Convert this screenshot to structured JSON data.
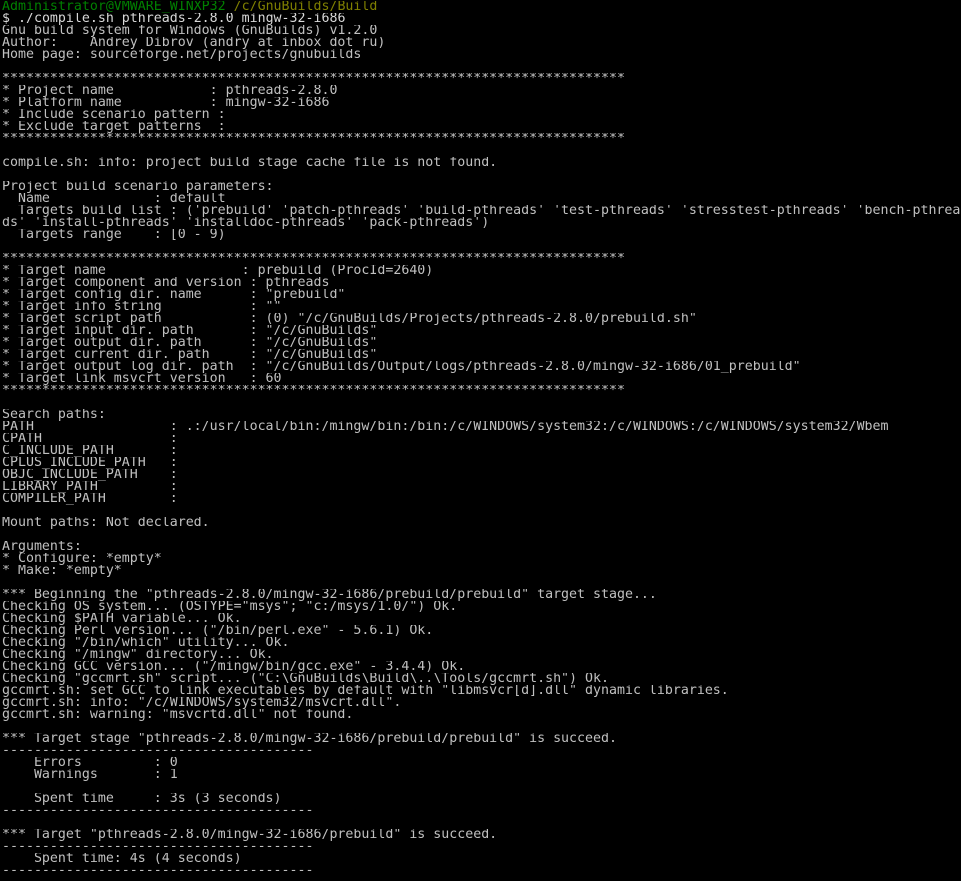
{
  "window": {
    "type": "terminal",
    "title": "MSYS bash shell",
    "columns": 119,
    "rows": 73,
    "background_color": "#000000",
    "foreground_color": "#c0c0c0",
    "prompt_user_color": "#008000",
    "prompt_path_color": "#808000"
  },
  "prompt": {
    "user_host": "Administrator@VMWARE_WINXP32",
    "separator": " ",
    "path": "/c/GnuBuilds/Build",
    "dollar": "$",
    "command": " ./compile.sh pthreads-2.8.0 mingw-32-i686"
  },
  "lines": [
    {
      "id": "prompt-line",
      "type": "prompt"
    },
    {
      "id": "command-line",
      "type": "command"
    },
    {
      "id": "banner-title",
      "text": "Gnu build system for Windows (GnuBuilds) v1.2.0"
    },
    {
      "id": "author",
      "text": "Author:    Andrey Dibrov (andry at inbox dot ru)"
    },
    {
      "id": "homepage",
      "text": "Home page: sourceforge.net/projects/gnubuilds"
    },
    {
      "id": "blank-1",
      "text": ""
    },
    {
      "id": "stars-1",
      "text": "******************************************************************************"
    },
    {
      "id": "project-name",
      "text": "* Project name            : pthreads-2.8.0"
    },
    {
      "id": "platform-name",
      "text": "* Platform name           : mingw-32-i686"
    },
    {
      "id": "include-scenario",
      "text": "* Include scenario pattern :"
    },
    {
      "id": "exclude-target",
      "text": "* Exclude target patterns  :"
    },
    {
      "id": "stars-2",
      "text": "******************************************************************************"
    },
    {
      "id": "blank-2",
      "text": ""
    },
    {
      "id": "cache-info",
      "text": "compile.sh: info: project build stage cache file is not found."
    },
    {
      "id": "blank-3",
      "text": ""
    },
    {
      "id": "scenario-header",
      "text": "Project build scenario parameters:"
    },
    {
      "id": "scenario-name",
      "text": "  Name             : default"
    },
    {
      "id": "targets-build-list-1",
      "text": "  Targets build list : ('prebuild' 'patch-pthreads' 'build-pthreads' 'test-pthreads' 'stresstest-pthreads' 'bench-pthrea"
    },
    {
      "id": "targets-build-list-2",
      "text": "ds' 'install-pthreads' 'installdoc-pthreads' 'pack-pthreads')"
    },
    {
      "id": "targets-range",
      "text": "  Targets range    : [0 - 9)"
    },
    {
      "id": "blank-4",
      "text": ""
    },
    {
      "id": "stars-3",
      "text": "******************************************************************************"
    },
    {
      "id": "target-name",
      "text": "* Target name                 : prebuild (ProcId=2640)"
    },
    {
      "id": "target-component",
      "text": "* Target component and version : pthreads"
    },
    {
      "id": "target-config-dir",
      "text": "* Target config dir. name      : \"prebuild\""
    },
    {
      "id": "target-info-string",
      "text": "* Target info string           : \"\""
    },
    {
      "id": "target-script-path",
      "text": "* Target script path           : (0) \"/c/GnuBuilds/Projects/pthreads-2.8.0/prebuild.sh\""
    },
    {
      "id": "target-input-dir",
      "text": "* Target input dir. path       : \"/c/GnuBuilds\""
    },
    {
      "id": "target-output-dir",
      "text": "* Target output dir. path      : \"/c/GnuBuilds\""
    },
    {
      "id": "target-current-dir",
      "text": "* Target current dir. path     : \"/c/GnuBuilds\""
    },
    {
      "id": "target-output-log-dir",
      "text": "* Target output log dir. path  : \"/c/GnuBuilds/Output/logs/pthreads-2.8.0/mingw-32-i686/01_prebuild\""
    },
    {
      "id": "target-link-msvcrt",
      "text": "* Target link msvcrt version   : 60"
    },
    {
      "id": "stars-4",
      "text": "******************************************************************************"
    },
    {
      "id": "blank-5",
      "text": ""
    },
    {
      "id": "search-paths-header",
      "text": "Search paths:"
    },
    {
      "id": "env-path",
      "text": "PATH                 : .:/usr/local/bin:/mingw/bin:/bin:/c/WINDOWS/system32:/c/WINDOWS:/c/WINDOWS/system32/Wbem"
    },
    {
      "id": "env-cpath",
      "text": "CPATH                :"
    },
    {
      "id": "env-c-include-path",
      "text": "C_INCLUDE_PATH       :"
    },
    {
      "id": "env-cplus-include-path",
      "text": "CPLUS_INCLUDE_PATH   :"
    },
    {
      "id": "env-objc-include-path",
      "text": "OBJC_INCLUDE_PATH    :"
    },
    {
      "id": "env-library-path",
      "text": "LIBRARY_PATH         :"
    },
    {
      "id": "env-compiler-path",
      "text": "COMPILER_PATH        :"
    },
    {
      "id": "blank-6",
      "text": ""
    },
    {
      "id": "mount-paths",
      "text": "Mount paths: Not declared."
    },
    {
      "id": "blank-7",
      "text": ""
    },
    {
      "id": "arguments-header",
      "text": "Arguments:"
    },
    {
      "id": "arg-configure",
      "text": "* Configure: *empty*"
    },
    {
      "id": "arg-make",
      "text": "* Make: *empty*"
    },
    {
      "id": "blank-8",
      "text": ""
    },
    {
      "id": "beginning-stage",
      "text": "*** Beginning the \"pthreads-2.8.0/mingw-32-i686/prebuild/prebuild\" target stage..."
    },
    {
      "id": "check-os",
      "text": "Checking OS system... (OSTYPE=\"msys\"; \"c:/msys/1.0/\") Ok."
    },
    {
      "id": "check-path-var",
      "text": "Checking $PATH variable... Ok."
    },
    {
      "id": "check-perl",
      "text": "Checking Perl version... (\"/bin/perl.exe\" - 5.6.1) Ok."
    },
    {
      "id": "check-which",
      "text": "Checking \"/bin/which\" utility... Ok."
    },
    {
      "id": "check-mingw-dir",
      "text": "Checking \"/mingw\" directory... Ok."
    },
    {
      "id": "check-gcc",
      "text": "Checking GCC version... (\"/mingw/bin/gcc.exe\" - 3.4.4) Ok."
    },
    {
      "id": "check-gccmrt",
      "text": "Checking \"gccmrt.sh\" script... (\"C:\\GnuBuilds\\Build\\..\\Tools/gccmrt.sh\") Ok."
    },
    {
      "id": "gccmrt-set",
      "text": "gccmrt.sh: set GCC to link executables by default with \"libmsvcr[d].dll\" dynamic libraries."
    },
    {
      "id": "gccmrt-info",
      "text": "gccmrt.sh: info: \"/c/WINDOWS/system32/msvcrt.dll\"."
    },
    {
      "id": "gccmrt-warning",
      "text": "gccmrt.sh: warning: \"msvcrtd.dll\" not found."
    },
    {
      "id": "blank-9",
      "text": ""
    },
    {
      "id": "stage-succeed",
      "text": "*** Target stage \"pthreads-2.8.0/mingw-32-i686/prebuild/prebuild\" is succeed."
    },
    {
      "id": "dashes-1",
      "text": "---------------------------------------"
    },
    {
      "id": "errors",
      "text": "    Errors         : 0"
    },
    {
      "id": "warnings",
      "text": "    Warnings       : 1"
    },
    {
      "id": "blank-10",
      "text": ""
    },
    {
      "id": "spent-time-stage",
      "text": "    Spent time     : 3s (3 seconds)"
    },
    {
      "id": "dashes-2",
      "text": "---------------------------------------"
    },
    {
      "id": "blank-11",
      "text": ""
    },
    {
      "id": "target-succeed",
      "text": "*** Target \"pthreads-2.8.0/mingw-32-i686/prebuild\" is succeed."
    },
    {
      "id": "dashes-3",
      "text": "---------------------------------------"
    },
    {
      "id": "spent-time-target",
      "text": "    Spent time: 4s (4 seconds)"
    },
    {
      "id": "dashes-4",
      "text": "---------------------------------------"
    }
  ]
}
